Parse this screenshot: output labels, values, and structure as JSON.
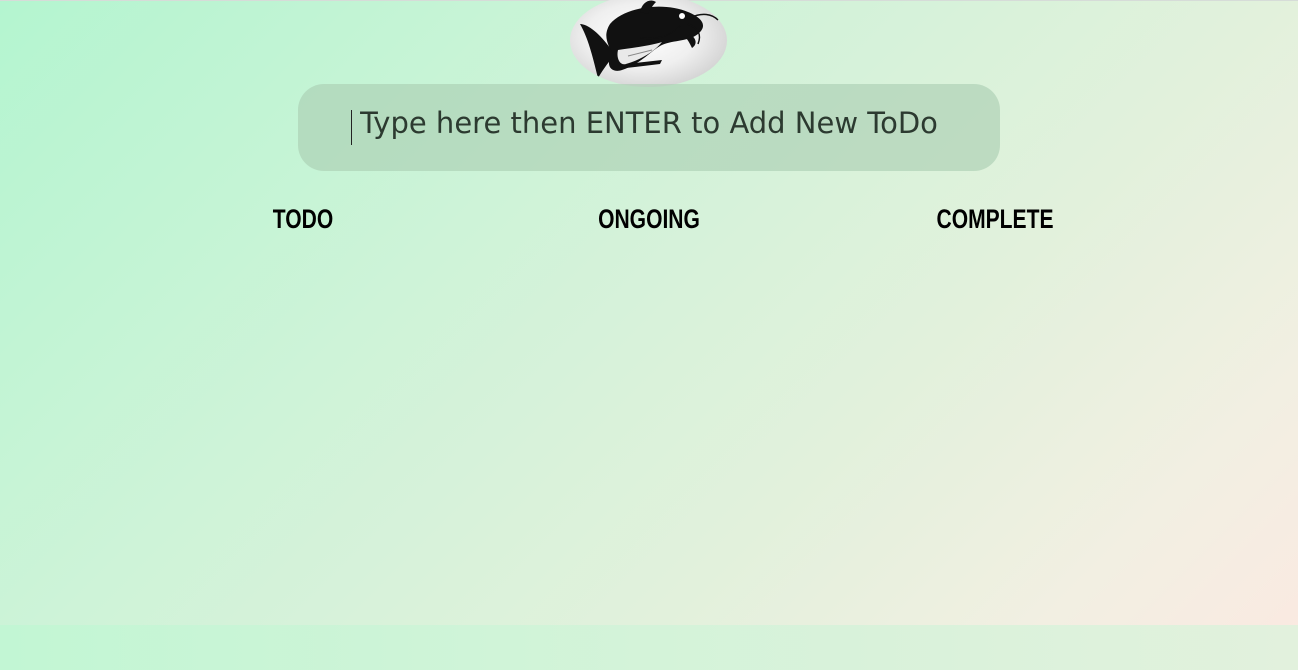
{
  "logo": {
    "alt": "catfish logo",
    "icon": "catfish-icon"
  },
  "todo_input": {
    "placeholder": "Type here then ENTER to Add New ToDo",
    "value": ""
  },
  "columns": [
    {
      "label": "TODO",
      "items": []
    },
    {
      "label": "ONGOING",
      "items": []
    },
    {
      "label": "COMPLETE",
      "items": []
    }
  ],
  "colors": {
    "background_start": "#b4f5d0",
    "background_end": "#fbe9e1",
    "input_background": "#b3d6bc",
    "text": "#000000"
  }
}
